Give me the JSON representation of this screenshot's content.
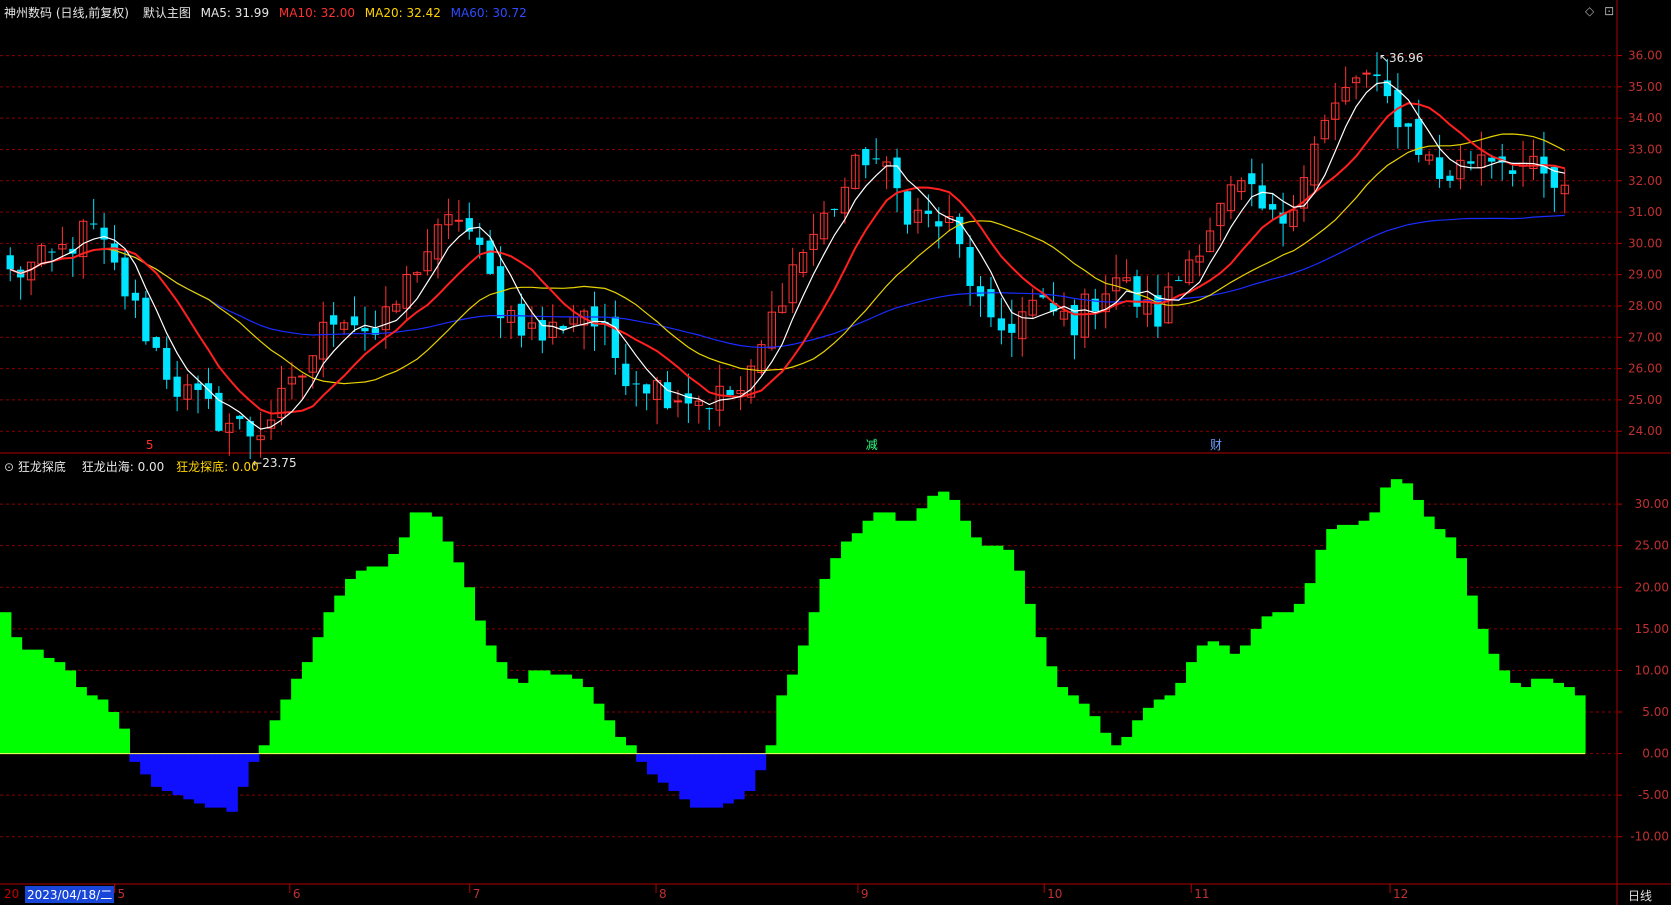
{
  "header": {
    "title": "神州数码 (日线,前复权)",
    "template": "默认主图",
    "ma5": "MA5: 31.99",
    "ma10": "MA10: 32.00",
    "ma20": "MA20: 32.42",
    "ma60": "MA60: 30.72"
  },
  "sub_header": {
    "title": "狂龙探底",
    "line1": "狂龙出海: 0.00",
    "line2": "狂龙探底: 0.00"
  },
  "footer": {
    "date_cursor": "2023/04/18/二",
    "year_prefix": "20",
    "period": "日线"
  },
  "colors": {
    "up": "#ff3333",
    "down": "#00e5ff",
    "ma5": "#ffffff",
    "ma10": "#ff2020",
    "ma20": "#e6d200",
    "ma60": "#1a2cff",
    "osc_pos": "#00ff00",
    "osc_neg": "#1010ff",
    "grid": "#8b0000"
  },
  "chart_data": [
    {
      "type": "candlestick",
      "ylim": [
        23.4,
        37.2
      ],
      "yticks": [
        "24.00",
        "25.00",
        "26.00",
        "27.00",
        "28.00",
        "29.00",
        "30.00",
        "31.00",
        "32.00",
        "33.00",
        "34.00",
        "35.00",
        "36.00"
      ],
      "month_labels": [
        "5",
        "6",
        "7",
        "8",
        "9",
        "10",
        "11",
        "12"
      ],
      "high_annotation": "36.96",
      "low_annotation": "23.75",
      "event_markers": [
        "5",
        "减",
        "财"
      ],
      "key_closes": [
        29.0,
        29.5,
        30.5,
        28.0,
        25.5,
        24.5,
        23.9,
        25.5,
        28.0,
        27.0,
        29.5,
        31.0,
        28.0,
        27.0,
        28.0,
        26.0,
        25.3,
        25.0,
        25.3,
        29.0,
        31.0,
        33.0,
        31.0,
        30.5,
        27.0,
        28.0,
        27.5,
        29.0,
        27.5,
        30.0,
        31.8,
        30.5,
        33.5,
        35.5,
        34.0,
        32.0,
        33.0,
        32.5,
        31.5
      ]
    },
    {
      "type": "bar",
      "title": "狂龙探底",
      "ylim": [
        -14,
        33.5
      ],
      "yticks": [
        "30.00",
        "25.00",
        "20.00",
        "15.00",
        "10.00",
        "5.00",
        "0.00",
        "-5.00",
        "-10.00"
      ],
      "values": [
        17,
        14,
        12.5,
        12.5,
        11.5,
        11,
        10,
        8,
        7,
        6.5,
        5,
        3,
        -1,
        -2.5,
        -4,
        -4.5,
        -5,
        -5.5,
        -6,
        -6.5,
        -6.5,
        -7,
        -4,
        -1,
        1,
        4,
        6.5,
        9,
        11,
        14,
        17,
        19,
        21,
        22,
        22.5,
        22.5,
        24,
        26,
        29,
        29,
        28.5,
        25.5,
        23,
        20,
        16,
        13,
        11,
        9,
        8.5,
        10,
        10,
        9.5,
        9.5,
        9,
        8,
        6,
        4,
        2,
        1,
        -1,
        -2.5,
        -3.5,
        -4.5,
        -5.5,
        -6.5,
        -6.5,
        -6.5,
        -6,
        -5.5,
        -4.5,
        -2,
        1,
        7,
        9.5,
        13,
        17,
        21,
        23.5,
        25.5,
        26.5,
        28,
        29,
        29,
        28,
        28,
        29.5,
        31,
        31.5,
        30.5,
        28,
        26,
        25,
        25,
        24.5,
        22,
        18,
        14,
        10.5,
        8,
        7,
        6,
        4.5,
        2.5,
        1,
        2,
        4,
        5.5,
        6.5,
        7,
        8.5,
        11,
        13,
        13.5,
        13,
        12,
        13,
        15,
        16.5,
        17,
        17,
        18,
        20.5,
        24.5,
        27,
        27.5,
        27.5,
        28,
        29,
        32,
        33,
        32.5,
        30.5,
        28.5,
        27,
        26,
        23.5,
        19,
        15,
        12,
        10,
        8.5,
        8,
        9,
        9,
        8.5,
        8,
        7
      ]
    }
  ]
}
